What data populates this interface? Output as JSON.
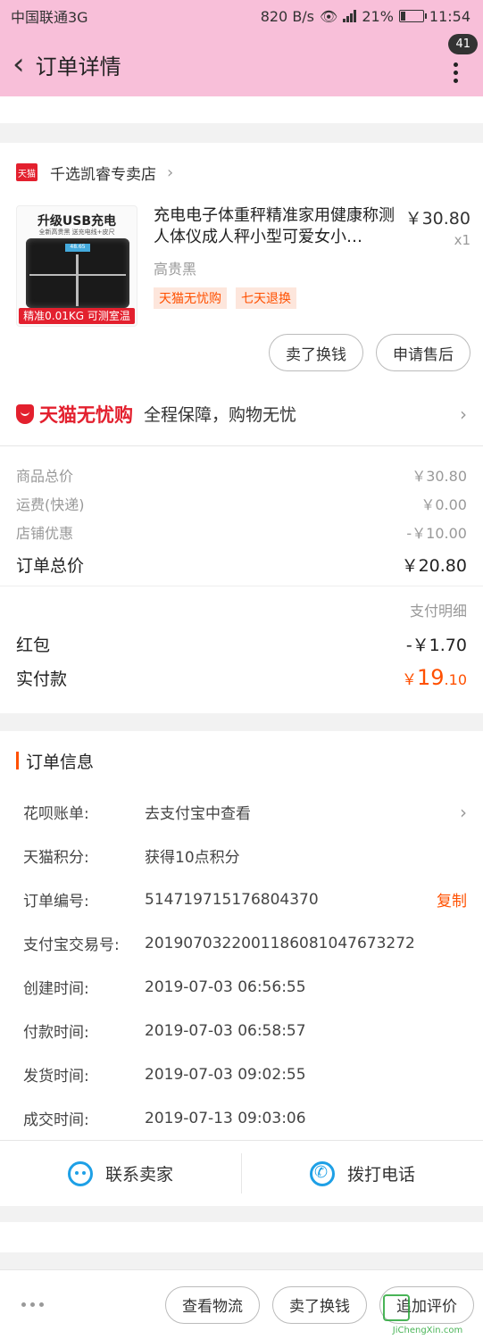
{
  "status": {
    "carrier": "中国联通3G",
    "speed": "820 B/s",
    "battery": "21%",
    "battery_level": 0.21,
    "time": "11:54"
  },
  "header": {
    "title": "订单详情",
    "badge": "41"
  },
  "shop": {
    "name": "千选凯睿专卖店",
    "logo_text": "天猫"
  },
  "product": {
    "image_title": "升级USB充电",
    "image_subtitle": "全新高贵黑 送充电线+皮尺",
    "image_tag": "精准0.01KG 可测室温",
    "name": "充电电子体重秤精准家用健康称测人体仪成人秤小型可爱女小…",
    "price": "￥30.80",
    "qty": "x1",
    "sku": "高贵黑",
    "tags": [
      "天猫无忧购",
      "七天退换"
    ]
  },
  "product_buttons": {
    "exchange": "卖了换钱",
    "after_sale": "申请售后"
  },
  "wuyou": {
    "logo": "天猫无忧购",
    "text": "全程保障，购物无忧"
  },
  "prices": {
    "goods_label": "商品总价",
    "goods_value": "￥30.80",
    "ship_label": "运费(快递)",
    "ship_value": "￥0.00",
    "discount_label": "店铺优惠",
    "discount_value": "-￥10.00",
    "total_label": "订单总价",
    "total_value": "￥20.80"
  },
  "payment": {
    "detail_link": "支付明细",
    "redpack_label": "红包",
    "redpack_value": "-￥1.70",
    "actual_label": "实付款",
    "actual_symbol": "￥",
    "actual_int": "19",
    "actual_dec": ".10"
  },
  "order_info": {
    "title": "订单信息",
    "rows": [
      {
        "k": "花呗账单:",
        "v": "去支付宝中查看"
      },
      {
        "k": "天猫积分:",
        "v": "获得10点积分"
      },
      {
        "k": "订单编号:",
        "v": "514719715176804370",
        "action": "复制"
      },
      {
        "k": "支付宝交易号:",
        "v": "2019070322001186081047673272"
      },
      {
        "k": "创建时间:",
        "v": "2019-07-03 06:56:55"
      },
      {
        "k": "付款时间:",
        "v": "2019-07-03 06:58:57"
      },
      {
        "k": "发货时间:",
        "v": "2019-07-03 09:02:55"
      },
      {
        "k": "成交时间:",
        "v": "2019-07-13 09:03:06"
      }
    ]
  },
  "contact": {
    "seller": "联系卖家",
    "phone": "拨打电话"
  },
  "bottom": {
    "logistics": "查看物流",
    "exchange": "卖了换钱",
    "review": "追加评价"
  },
  "watermark": {
    "text": "JiChengXin.com"
  }
}
